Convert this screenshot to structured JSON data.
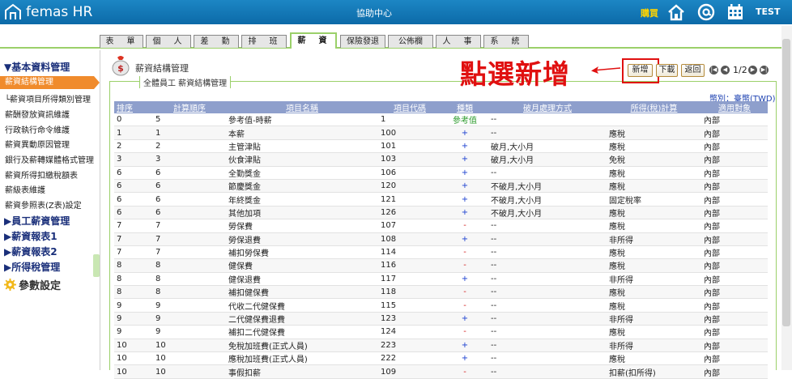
{
  "header": {
    "logo_text": "femas HR",
    "center_title": "協助中心",
    "purchase_label": "購買",
    "user": "TEST",
    "icons": [
      "home-icon",
      "at-icon",
      "calendar-icon"
    ]
  },
  "tabs": [
    "表　單",
    "個　人",
    "差　勤",
    "排　班",
    "薪　資",
    "保險發退",
    "公佈欄",
    "人　事",
    "系　統"
  ],
  "active_tab": 4,
  "sidebar": {
    "section_basic": "▼基本資料管理",
    "items": [
      "薪資結構管理",
      "└薪資項目所得類別管理",
      "薪酬發放資訊維護",
      "行政執行命令維護",
      "薪資異動原因管理",
      "銀行及薪轉媒體格式管理",
      "薪資所得扣繳稅額表",
      "薪級表維護",
      "薪資參照表(Z表)設定"
    ],
    "sections": [
      "▶員工薪資管理",
      "▶薪資報表1",
      "▶薪資報表2",
      "▶所得稅管理"
    ],
    "settings_label": "參數設定"
  },
  "page": {
    "title": "薪資結構管理",
    "fieldset_label": "全體員工 薪資結構管理",
    "annotation": "點選新增",
    "buttons": {
      "add": "新增",
      "download": "下載",
      "back": "返回"
    },
    "pager": "1/2",
    "currency": "幣別：臺幣(TWD)"
  },
  "table": {
    "headers": [
      "排序",
      "計算順序",
      "項目名稱",
      "項目代碼",
      "種類",
      "破月處理方式",
      "所得(稅)計算",
      "適用對象"
    ],
    "rows": [
      [
        "0",
        "5",
        "參考值-時薪",
        "1",
        "參考值",
        "--",
        "",
        "內部"
      ],
      [
        "1",
        "1",
        "本薪",
        "100",
        "+",
        "--",
        "應稅",
        "內部"
      ],
      [
        "2",
        "2",
        "主管津貼",
        "101",
        "+",
        "破月,大小月",
        "應稅",
        "內部"
      ],
      [
        "3",
        "3",
        "伙食津貼",
        "103",
        "+",
        "破月,大小月",
        "免稅",
        "內部"
      ],
      [
        "6",
        "6",
        "全勤獎金",
        "106",
        "+",
        "--",
        "應稅",
        "內部"
      ],
      [
        "6",
        "6",
        "節慶獎金",
        "120",
        "+",
        "不破月,大小月",
        "應稅",
        "內部"
      ],
      [
        "6",
        "6",
        "年終獎金",
        "121",
        "+",
        "不破月,大小月",
        "固定稅率",
        "內部"
      ],
      [
        "6",
        "6",
        "其他加項",
        "126",
        "+",
        "不破月,大小月",
        "應稅",
        "內部"
      ],
      [
        "7",
        "7",
        "勞保費",
        "107",
        "-",
        "--",
        "應稅",
        "內部"
      ],
      [
        "7",
        "7",
        "勞保退費",
        "108",
        "+",
        "--",
        "非所得",
        "內部"
      ],
      [
        "7",
        "7",
        "補扣勞保費",
        "114",
        "-",
        "--",
        "應稅",
        "內部"
      ],
      [
        "8",
        "8",
        "健保費",
        "116",
        "-",
        "--",
        "應稅",
        "內部"
      ],
      [
        "8",
        "8",
        "健保退費",
        "117",
        "+",
        "--",
        "非所得",
        "內部"
      ],
      [
        "8",
        "8",
        "補扣健保費",
        "118",
        "-",
        "--",
        "應稅",
        "內部"
      ],
      [
        "9",
        "9",
        "代收二代健保費",
        "115",
        "-",
        "--",
        "應稅",
        "內部"
      ],
      [
        "9",
        "9",
        "二代健保費退費",
        "123",
        "+",
        "--",
        "非所得",
        "內部"
      ],
      [
        "9",
        "9",
        "補扣二代健保費",
        "124",
        "-",
        "--",
        "應稅",
        "內部"
      ],
      [
        "10",
        "10",
        "免稅加班費(正式人員)",
        "223",
        "+",
        "--",
        "非所得",
        "內部"
      ],
      [
        "10",
        "10",
        "應稅加班費(正式人員)",
        "222",
        "+",
        "--",
        "應稅",
        "內部"
      ],
      [
        "10",
        "10",
        "事假扣薪",
        "109",
        "-",
        "--",
        "扣薪(扣所得)",
        "內部"
      ]
    ]
  },
  "colors": {
    "header_blue": "#0f74b5",
    "tab_green": "#9bd06a",
    "active_orange": "#f08b2c",
    "annotation_red": "#e01010",
    "table_header": "#8e9fcc"
  }
}
